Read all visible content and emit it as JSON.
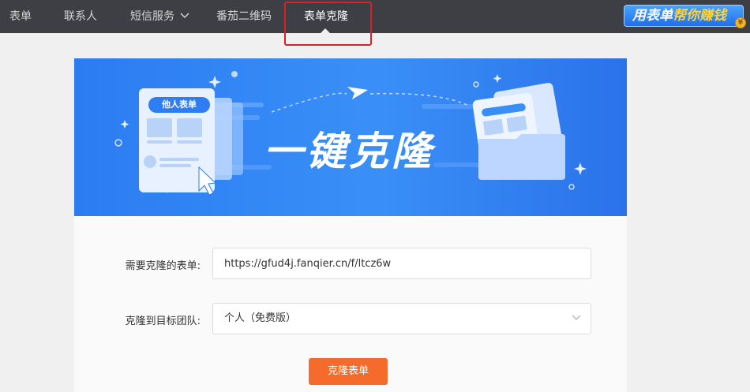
{
  "nav": {
    "items": [
      {
        "label": "表单"
      },
      {
        "label": "联系人"
      },
      {
        "label": "短信服务"
      },
      {
        "label": "番茄二维码"
      },
      {
        "label": "表单克隆"
      }
    ],
    "active_index": 4,
    "promo": {
      "part1": "用表单",
      "part2": "帮你赚钱"
    }
  },
  "banner": {
    "title": "一键克隆",
    "doc_tag": "他人表单"
  },
  "form": {
    "source_label": "需要克隆的表单:",
    "source_value": "https://gfud4j.fanqier.cn/f/ltcz6w",
    "team_label": "克隆到目标团队:",
    "team_value": "个人（免费版）",
    "submit_label": "克隆表单"
  },
  "colors": {
    "nav_bg": "#3d3f44",
    "banner_blue": "#3a8ff7",
    "accent_orange": "#f46b2c",
    "highlight_red": "#d8202a"
  }
}
